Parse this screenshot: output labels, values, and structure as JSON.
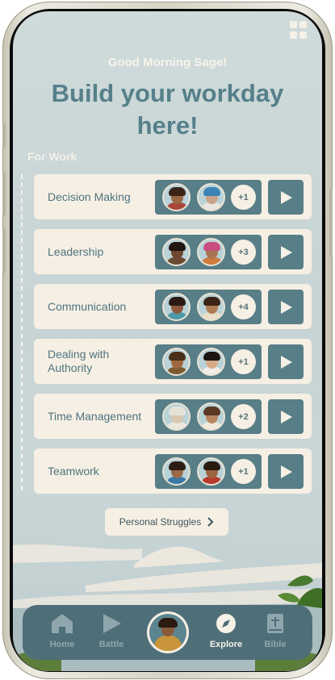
{
  "header": {
    "greeting": "Good Morning Sage!",
    "headline": "Build your workday here!",
    "menu_icon": "grid-icon"
  },
  "section": {
    "label": "For Work"
  },
  "topics": [
    {
      "title": "Decision Making",
      "extra": "+1"
    },
    {
      "title": "Leadership",
      "extra": "+3"
    },
    {
      "title": "Communication",
      "extra": "+4"
    },
    {
      "title": "Dealing with Authority",
      "extra": "+1"
    },
    {
      "title": "Time Management",
      "extra": "+2"
    },
    {
      "title": "Teamwork",
      "extra": "+1"
    }
  ],
  "struggles_button": {
    "label": "Personal Struggles",
    "icon": "chevron-right-icon"
  },
  "nav": {
    "items": [
      {
        "label": "Home",
        "icon": "home-icon"
      },
      {
        "label": "Battle",
        "icon": "play-icon"
      },
      {
        "label": "Explore",
        "icon": "compass-icon"
      },
      {
        "label": "Bible",
        "icon": "bible-icon"
      }
    ],
    "active": "Explore"
  },
  "colors": {
    "accent": "#587e87",
    "card": "#f6efe4",
    "headline": "#55808a",
    "nav_bg": "#4e6e78"
  }
}
